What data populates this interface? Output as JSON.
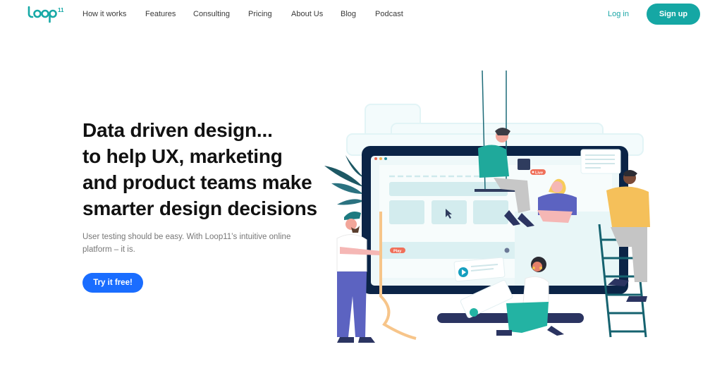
{
  "brand": {
    "logo_text": "loop",
    "logo_superscript": "11",
    "accent_color": "#15a7a4",
    "cta_color": "#1a6dff"
  },
  "nav": {
    "items": [
      {
        "label": "How it works"
      },
      {
        "label": "Features"
      },
      {
        "label": "Consulting"
      },
      {
        "label": "Pricing"
      },
      {
        "label": "About Us"
      },
      {
        "label": "Blog"
      },
      {
        "label": "Podcast"
      }
    ],
    "login_label": "Log in",
    "signup_label": "Sign up"
  },
  "hero": {
    "headline_lines": [
      "Data driven design...",
      "to help UX, marketing",
      "and product teams make",
      "smarter design decisions"
    ],
    "subtext": "User testing should be easy. With Loop11’s intuitive online platform – it is.",
    "cta_label": "Try it free!"
  },
  "illustration": {
    "live_badge": "Live",
    "play_badge": "Play"
  }
}
